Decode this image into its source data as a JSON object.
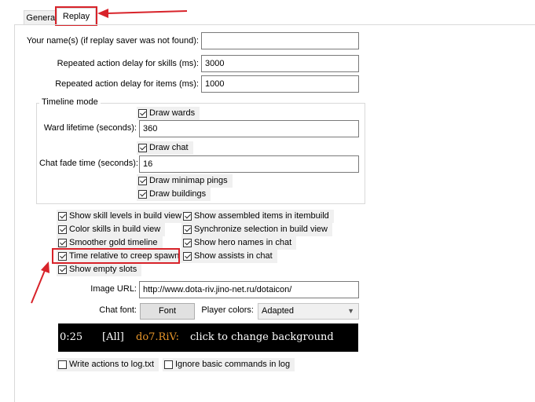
{
  "tabs": {
    "general": "General",
    "replay": "Replay"
  },
  "fields": {
    "name_label": "Your name(s) (if replay saver was not found):",
    "name_value": "",
    "skills_delay_label": "Repeated action delay for skills (ms):",
    "skills_delay_value": "3000",
    "items_delay_label": "Repeated action delay for items (ms):",
    "items_delay_value": "1000"
  },
  "timeline": {
    "title": "Timeline mode",
    "draw_wards": "Draw wards",
    "ward_lifetime_label": "Ward lifetime (seconds):",
    "ward_lifetime_value": "360",
    "draw_chat": "Draw chat",
    "chat_fade_label": "Chat fade time (seconds):",
    "chat_fade_value": "16",
    "draw_minimap_pings": "Draw minimap pings",
    "draw_buildings": "Draw buildings"
  },
  "options": {
    "show_skill_levels": "Show skill levels in build view",
    "color_skills": "Color skills in build view",
    "smoother_gold": "Smoother gold timeline",
    "time_relative": "Time relative to creep spawn",
    "show_empty_slots": "Show empty slots",
    "show_assembled": "Show assembled items in itembuild",
    "synchronize_selection": "Synchronize selection in build view",
    "show_hero_names": "Show hero names in chat",
    "show_assists": "Show assists in chat"
  },
  "image_url": {
    "label": "Image URL:",
    "value": "http://www.dota-riv.jino-net.ru/dotaicon/"
  },
  "chat_font": {
    "label": "Chat font:",
    "button": "Font"
  },
  "player_colors": {
    "label": "Player colors:",
    "selected": "Adapted"
  },
  "preview": {
    "time": "0:25",
    "channel": "[All]",
    "name": "do7.RiV:",
    "message": "click to change background"
  },
  "log": {
    "write_actions": "Write actions to log.txt",
    "ignore_basic": "Ignore basic commands in log"
  },
  "colors": {
    "highlight": "#d8232a",
    "preview_bg": "#000000",
    "preview_name": "#e8962a"
  }
}
